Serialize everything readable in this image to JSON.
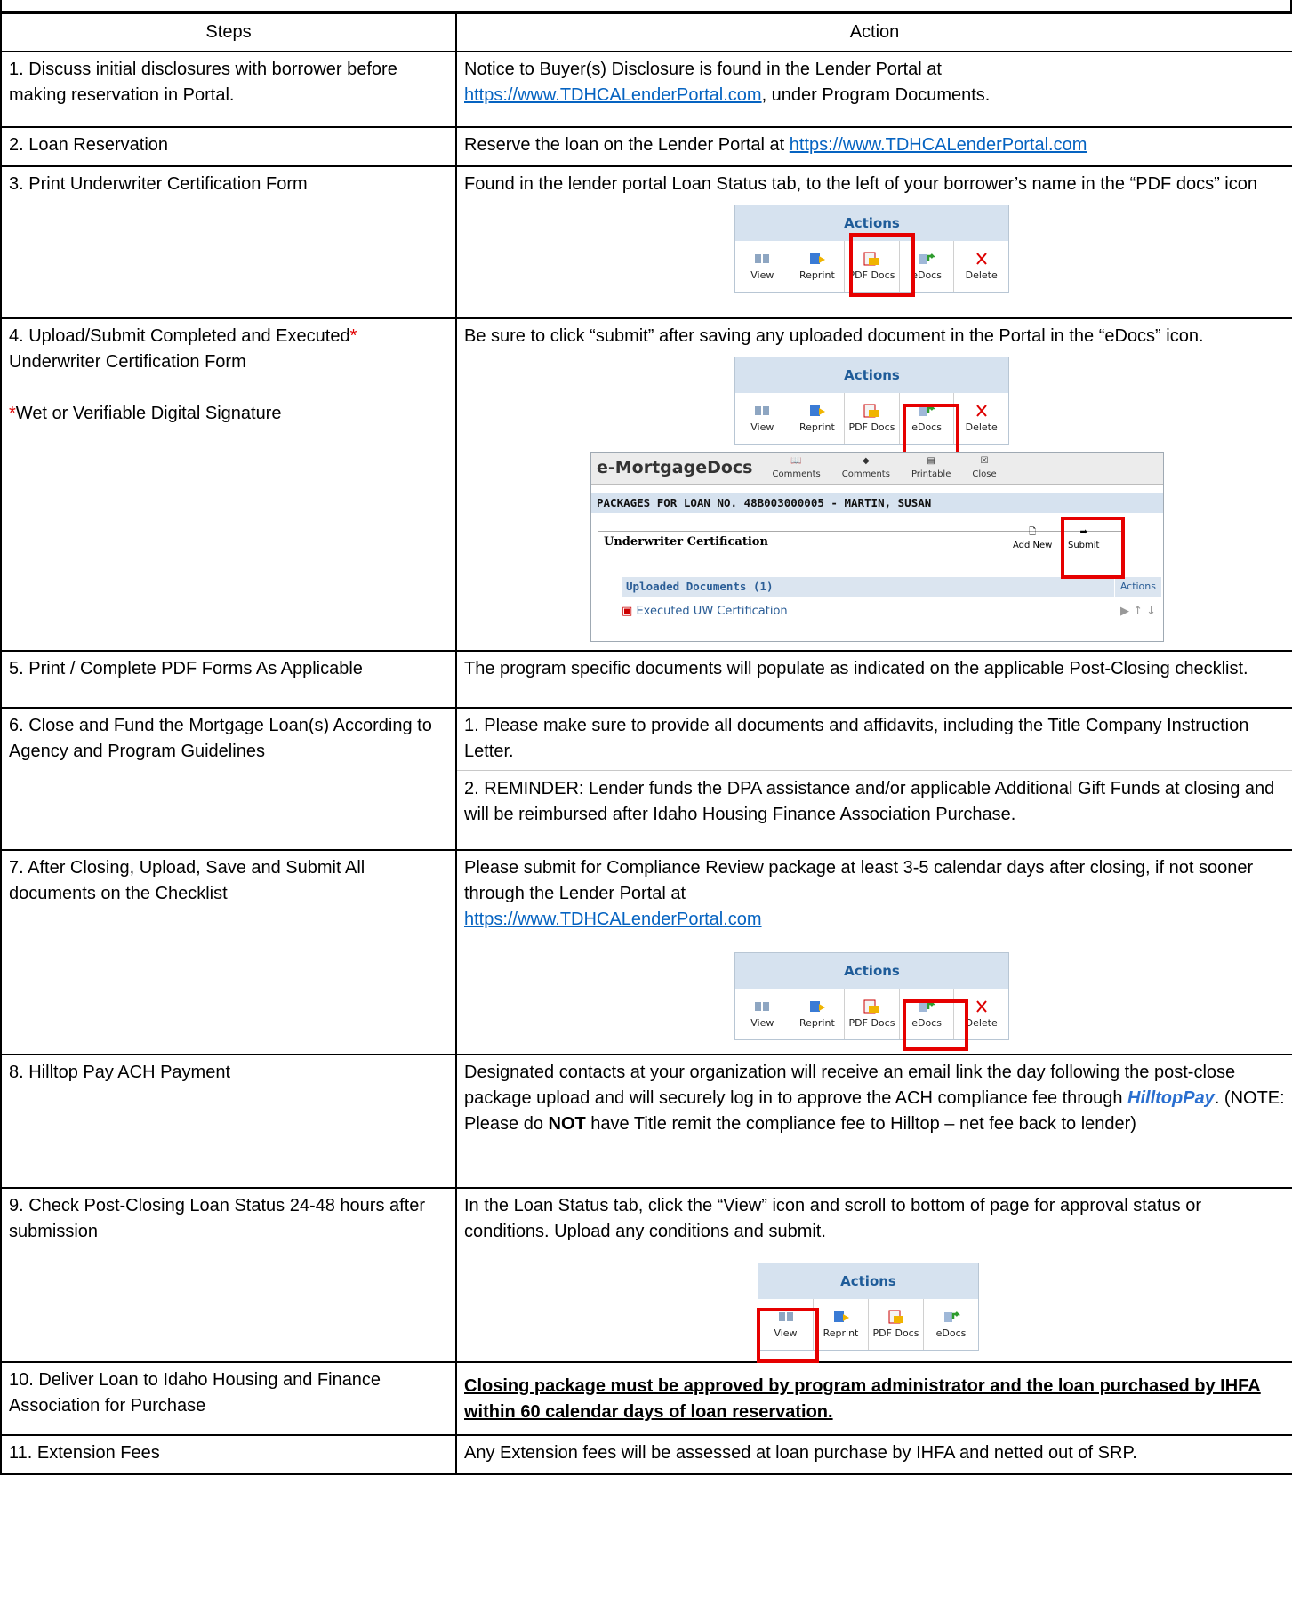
{
  "table": {
    "headers": {
      "steps": "Steps",
      "action": "Action"
    }
  },
  "rows": [
    {
      "step": "1. Discuss initial disclosures with borrower before making reservation in Portal.",
      "action_pre": "Notice to Buyer(s) Disclosure is found in the Lender Portal at",
      "link": "https://www.TDHCALenderPortal.com",
      "action_post": ", under Program Documents."
    },
    {
      "step": "2. Loan Reservation",
      "action_pre": "Reserve the loan on the Lender Portal at ",
      "link": "https://www.TDHCALenderPortal.com"
    },
    {
      "step": "3. Print Underwriter Certification Form",
      "action": "Found in the lender portal Loan Status tab, to the left of your borrower’s name in the “PDF docs” icon"
    },
    {
      "step_a": "4. Upload/Submit Completed and Executed",
      "step_star": "*",
      "step_b": " Underwriter Certification Form",
      "note_star": "*",
      "note": "Wet or Verifiable Digital Signature",
      "action": "Be sure to click “submit” after saving any uploaded document in the Portal in the “eDocs” icon."
    },
    {
      "step": "5. Print / Complete PDF Forms As Applicable",
      "action": "The program specific documents will populate as indicated on the applicable Post-Closing checklist."
    },
    {
      "step": "6. Close and Fund the Mortgage Loan(s) According to Agency and Program Guidelines",
      "action_1": "1. Please make sure to provide all documents and affidavits, including the Title Company Instruction Letter.",
      "action_2": "2. REMINDER:  Lender funds the DPA assistance and/or applicable Additional Gift Funds at closing and will be reimbursed after Idaho Housing Finance Association Purchase."
    },
    {
      "step": "7. After Closing, Upload, Save and Submit All documents on the Checklist",
      "action": "Please submit for Compliance Review package at least 3-5 calendar days after closing, if not sooner through the Lender Portal at",
      "link": "https://www.TDHCALenderPortal.com"
    },
    {
      "step": "8. Hilltop Pay ACH Payment",
      "action_a": "Designated contacts at your organization will receive an email link the day following the post-close package upload and will  securely log in to approve the ACH compliance fee through ",
      "brand": "HilltopPay",
      "action_b": ".  (NOTE:  Please do ",
      "not": "NOT",
      "action_c": " have Title remit the compliance fee to Hilltop – net fee back to lender)"
    },
    {
      "step": "9. Check Post-Closing Loan Status 24-48 hours after submission",
      "action": "In the Loan Status tab, click the “View” icon and scroll to bottom of page for approval status or conditions.  Upload any conditions and submit."
    },
    {
      "step": "10. Deliver Loan to Idaho Housing and Finance Association for Purchase",
      "action": "Closing package must be approved by program administrator and the loan purchased by IHFA within 60 calendar days of loan reservation."
    },
    {
      "step": "11. Extension Fees",
      "action": "Any Extension fees will be assessed at loan purchase by IHFA and netted out of SRP."
    }
  ],
  "actions_widget": {
    "title": "Actions",
    "buttons": [
      "View",
      "Reprint",
      "PDF Docs",
      "eDocs",
      "Delete"
    ],
    "buttons_view": [
      "View",
      "Reprint",
      "PDF Docs",
      "eDocs"
    ]
  },
  "edocs_widget": {
    "title": "e-MortgageDocs",
    "tools": [
      "Comments",
      "Comments",
      "Printable",
      "Close"
    ],
    "package": "PACKAGES FOR LOAN NO. 48B003000005 - MARTIN, SUSAN",
    "section": "Underwriter Certification",
    "add_new": "Add New",
    "submit": "Submit",
    "uploaded": "Uploaded Documents (1)",
    "actions": "Actions",
    "document": "Executed UW Certification"
  },
  "colors": {
    "highlight": "#e60000",
    "link": "#0563c1",
    "header_blue": "#d6e2ef"
  }
}
